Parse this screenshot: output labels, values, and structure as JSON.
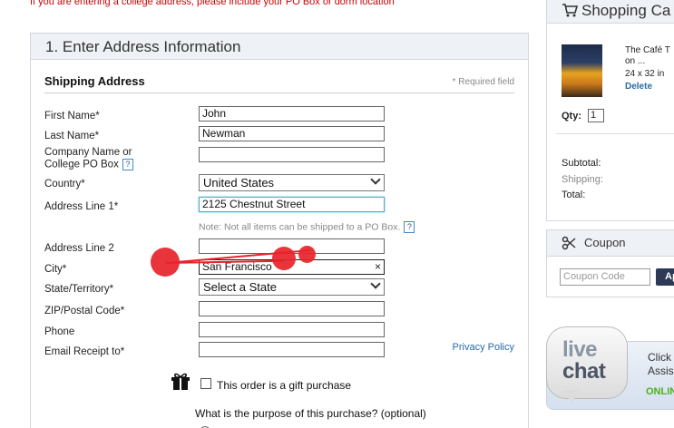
{
  "notice": "If you are entering a college address, please include your PO Box or dorm location",
  "form": {
    "step_title": "1. Enter Address Information",
    "section_title": "Shipping Address",
    "required_note": "* Required field",
    "labels": {
      "first_name": "First Name*",
      "last_name": "Last Name*",
      "company_1": "Company Name or",
      "company_2": "College PO Box",
      "country": "Country*",
      "address1": "Address Line 1*",
      "address2": "Address Line 2",
      "city": "City*",
      "state": "State/Territory*",
      "zip": "ZIP/Postal Code*",
      "phone": "Phone",
      "email": "Email Receipt to*"
    },
    "values": {
      "first_name": "John",
      "last_name": "Newman",
      "company": "",
      "country": "United States",
      "address1": "2125 Chestnut Street",
      "address2": "",
      "city": "San Francisco",
      "state": "Select a State",
      "zip": "",
      "phone": "",
      "email": ""
    },
    "po_box_note": "Note: Not all items can be shipped to a PO Box.",
    "help_glyph": "?",
    "clear_glyph": "×",
    "privacy_link": "Privacy Policy",
    "gift_label": "This order is a gift purchase",
    "purpose_question": "What is the purpose of this purchase? (optional)"
  },
  "cart": {
    "title": "Shopping Ca",
    "item_title_1": "The Café T",
    "item_title_2": "on ...",
    "item_size": "24 x 32 in",
    "delete": "Delete",
    "qty_label": "Qty:",
    "qty_value": "1",
    "subtotal": "Subtotal:",
    "shipping": "Shipping:",
    "total": "Total:"
  },
  "coupon": {
    "title": "Coupon",
    "placeholder": "Coupon Code",
    "apply": "Ap"
  },
  "livechat": {
    "live": "live",
    "chat": "chat",
    "click_1": "Click",
    "click_2": "Assis",
    "online": "ONLIN"
  },
  "colors": {
    "notice_red": "#cc0000",
    "link_blue": "#2a6aa8",
    "header_bg": "#eef1f5",
    "annotation_red": "#e8232b",
    "online_green": "#4caf1f"
  },
  "icons": [
    "help-icon",
    "gift-icon",
    "cart-icon",
    "scissors-icon",
    "chevron-down-icon",
    "clear-icon"
  ]
}
